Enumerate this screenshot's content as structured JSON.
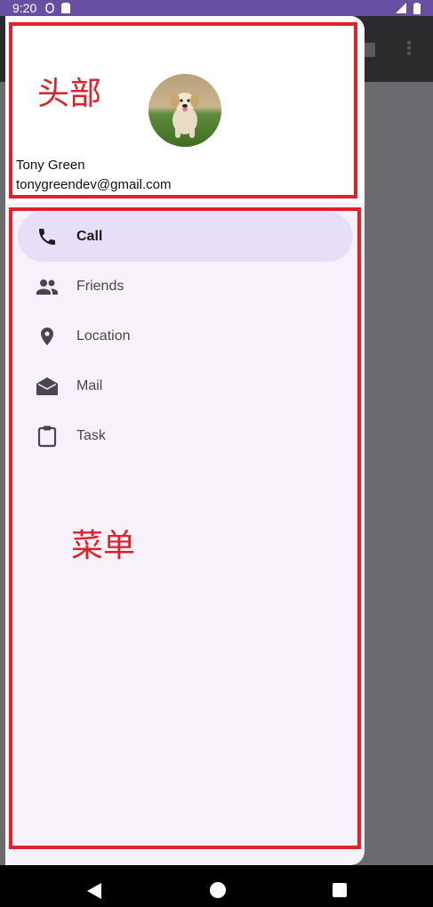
{
  "status_bar": {
    "time": "9:20"
  },
  "header": {
    "annotation": "头部",
    "user_name": "Tony Green",
    "user_email": "tonygreendev@gmail.com"
  },
  "menu": {
    "annotation": "菜单",
    "items": [
      {
        "label": "Call",
        "icon": "phone-icon",
        "selected": true
      },
      {
        "label": "Friends",
        "icon": "people-icon",
        "selected": false
      },
      {
        "label": "Location",
        "icon": "location-pin-icon",
        "selected": false
      },
      {
        "label": "Mail",
        "icon": "mail-open-icon",
        "selected": false
      },
      {
        "label": "Task",
        "icon": "clipboard-icon",
        "selected": false
      }
    ]
  },
  "colors": {
    "accent": "#6750a4",
    "selected_bg": "#e8def8",
    "annotation_red": "#e0202b"
  }
}
